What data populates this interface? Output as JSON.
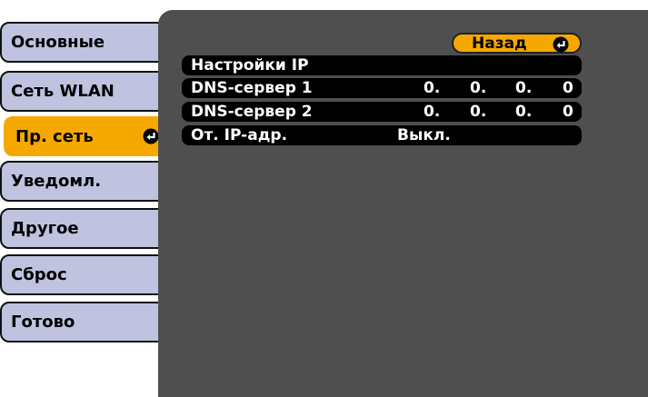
{
  "menu": {
    "tabs": [
      {
        "label": "Основные"
      },
      {
        "label": "Сеть WLAN"
      },
      {
        "label": "Пр. сеть",
        "active": true
      },
      {
        "label": "Уведомл."
      },
      {
        "label": "Другое"
      },
      {
        "label": "Сброс"
      },
      {
        "label": "Готово"
      }
    ]
  },
  "panel": {
    "back_label": "Назад",
    "rows": [
      {
        "label": "Настройки IP"
      },
      {
        "label": "DNS-сервер 1",
        "octets": [
          "0.",
          "0.",
          "0.",
          "0"
        ]
      },
      {
        "label": "DNS-сервер 2",
        "octets": [
          "0.",
          "0.",
          "0.",
          "0"
        ]
      },
      {
        "label": "От. IP-адр.",
        "value": "Выкл."
      }
    ]
  },
  "colors": {
    "accent": "#f5a800",
    "tab_bg": "#bfc3e0",
    "panel_bg": "#4f4f4f",
    "row_bg": "#000000"
  },
  "icons": {
    "enter": "enter-icon"
  }
}
